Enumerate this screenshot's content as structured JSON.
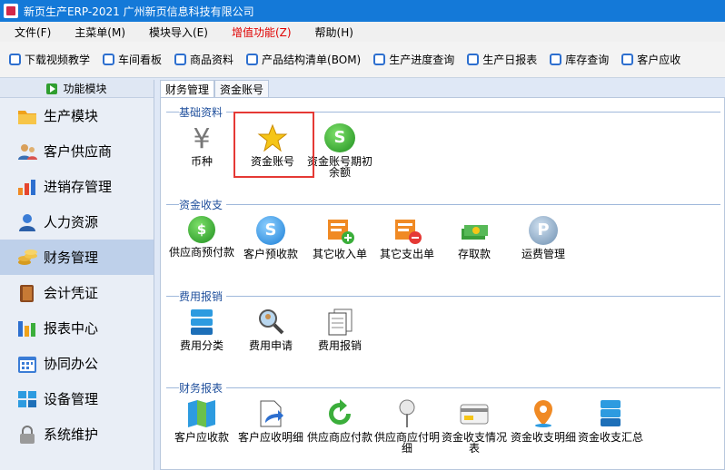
{
  "window": {
    "title": "新页生产ERP-2021 广州新页信息科技有限公司"
  },
  "menu": [
    {
      "label": "文件(F)"
    },
    {
      "label": "主菜单(M)"
    },
    {
      "label": "模块导入(E)"
    },
    {
      "label": "增值功能(Z)"
    },
    {
      "label": "帮助(H)"
    }
  ],
  "toolbar": [
    {
      "label": "下载视频教学"
    },
    {
      "label": "车间看板"
    },
    {
      "label": "商品资料"
    },
    {
      "label": "产品结构清单(BOM)"
    },
    {
      "label": "生产进度查询"
    },
    {
      "label": "生产日报表"
    },
    {
      "label": "库存查询"
    },
    {
      "label": "客户应收"
    }
  ],
  "sidebar": {
    "header": "功能模块",
    "items": [
      {
        "label": "生产模块"
      },
      {
        "label": "客户供应商"
      },
      {
        "label": "进销存管理"
      },
      {
        "label": "人力资源"
      },
      {
        "label": "财务管理"
      },
      {
        "label": "会计凭证"
      },
      {
        "label": "报表中心"
      },
      {
        "label": "协同办公"
      },
      {
        "label": "设备管理"
      },
      {
        "label": "系统维护"
      }
    ]
  },
  "tabs": [
    {
      "label": "财务管理"
    },
    {
      "label": "资金账号"
    }
  ],
  "groups": {
    "basic": {
      "title": "基础资料",
      "items": [
        {
          "label": "币种"
        },
        {
          "label": "资金账号"
        },
        {
          "label": "资金账号期初余额"
        }
      ]
    },
    "cash": {
      "title": "资金收支",
      "items": [
        {
          "label": "供应商预付款"
        },
        {
          "label": "客户预收款"
        },
        {
          "label": "其它收入单"
        },
        {
          "label": "其它支出单"
        },
        {
          "label": "存取款"
        },
        {
          "label": "运费管理"
        }
      ]
    },
    "expense": {
      "title": "费用报销",
      "items": [
        {
          "label": "费用分类"
        },
        {
          "label": "费用申请"
        },
        {
          "label": "费用报销"
        }
      ]
    },
    "report": {
      "title": "财务报表",
      "items": [
        {
          "label": "客户应收款"
        },
        {
          "label": "客户应收明细"
        },
        {
          "label": "供应商应付款"
        },
        {
          "label": "供应商应付明细"
        },
        {
          "label": "资金收支情况表"
        },
        {
          "label": "资金收支明细"
        },
        {
          "label": "资金收支汇总"
        }
      ]
    }
  }
}
